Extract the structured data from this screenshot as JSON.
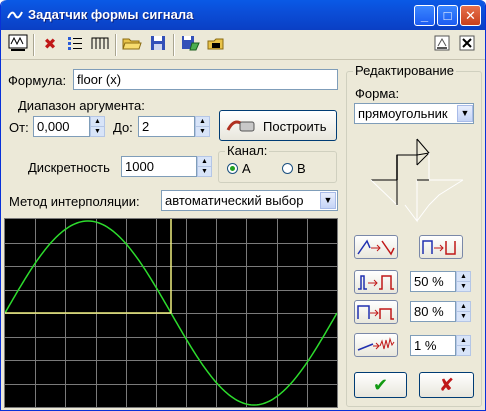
{
  "window": {
    "title": "Задатчик формы сигнала",
    "buttons": {
      "minimize": "_",
      "maximize": "□",
      "close": "✕"
    }
  },
  "toolbar": {
    "icons": [
      "signal-icon",
      "delete-icon",
      "list-icon",
      "bars-icon",
      "open-icon",
      "save-icon",
      "save-as-icon",
      "print-icon"
    ],
    "right_icons": [
      "dock-icon",
      "close-panel-icon"
    ]
  },
  "form": {
    "formula_label": "Формула:",
    "formula_value": "floor (x)",
    "range_label": "Диапазон аргумента:",
    "from_label": "От:",
    "from_value": "0,000",
    "to_label": "До:",
    "to_value": "2",
    "build_label": "Построить",
    "discrete_label": "Дискретность",
    "discrete_value": "1000",
    "channel_label": "Канал:",
    "channel_a": "A",
    "channel_b": "B",
    "channel_selected": "A",
    "interp_label": "Метод интерполяции:",
    "interp_value": "автоматический выбор"
  },
  "edit": {
    "group_title": "Редактирование",
    "form_label": "Форма:",
    "form_value": "прямоугольник",
    "duty1": "50 %",
    "duty2": "80 %",
    "noise": "1 %"
  },
  "plot": {
    "background": "#000000",
    "grid_color": "#7a7a7a",
    "sine_color": "#2ddc2d",
    "square_color": "#f0f080"
  },
  "actions": {
    "ok": "✔",
    "cancel": "✘"
  }
}
